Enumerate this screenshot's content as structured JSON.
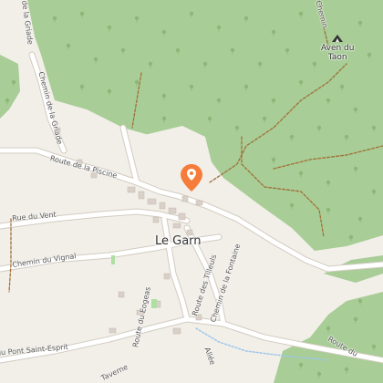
{
  "map": {
    "place_name": "Le Garn",
    "roads": {
      "route_piscine": "Route de la Piscine",
      "chemin_gniade": "Chemin de la Griade",
      "chemin_gniade_short": "de la Griade",
      "rue_vent": "Rue du Vent",
      "chemin_vignal": "Chemin du Vignal",
      "route_eogeas": "Route du Eogeas",
      "route_tilleuls": "Route des Tilleuls",
      "chemin_fontaine": "Chemin de la Fontaine",
      "route_pont": "Route du Pont Saint-Esprit",
      "route_east": "Route du",
      "chemin_top": "Chemin",
      "taverne": "Taverne",
      "allee": "Allée"
    },
    "poi": {
      "cave_name_line1": "Aven du",
      "cave_name_line2": "Taon"
    },
    "colors": {
      "forest": "#a8cd96",
      "land": "#f2efe9",
      "road": "#ffffff",
      "road_casing": "#d2cbc0",
      "track": "#a0703a",
      "marker": "#f57c3a",
      "building": "#d9d0c9"
    },
    "icons": {
      "marker": "map-pin-icon",
      "cave": "cave-icon",
      "tree": "tree-icon"
    }
  }
}
